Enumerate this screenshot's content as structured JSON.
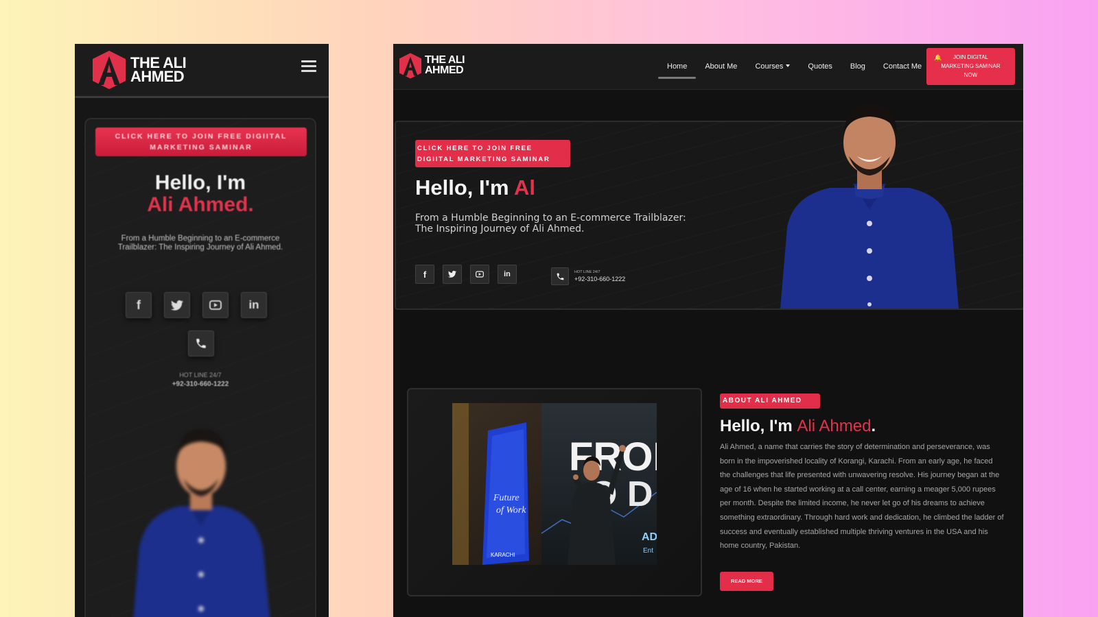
{
  "brand": {
    "logo_line1": "THE ALI",
    "logo_line2": "AHMED",
    "accent": "#e5324c"
  },
  "mobile": {
    "cta": "CLICK HERE TO JOIN FREE DIGIITAL MARKETING SAMINAR",
    "hello": "Hello, I'm",
    "name": "Ali Ahmed.",
    "subtitle": "From a Humble Beginning to an E-commerce Trailblazer: The Inspiring Journey of Ali Ahmed.",
    "hotline_label": "HOT LINE 24/7",
    "hotline_number": "+92-310-660-1222",
    "social_icons": [
      "facebook-icon",
      "twitter-icon",
      "youtube-icon",
      "linkedin-icon"
    ]
  },
  "desktop": {
    "nav": {
      "items": [
        {
          "label": "Home",
          "active": true
        },
        {
          "label": "About Me"
        },
        {
          "label": "Courses",
          "dropdown": true
        },
        {
          "label": "Quotes"
        },
        {
          "label": "Blog"
        },
        {
          "label": "Contact Me"
        }
      ],
      "join_button": "JOIN DIGITAL MARKETING SAMINAR NOW"
    },
    "hero": {
      "cta": "CLICK HERE TO JOIN FREE DIGIITAL MARKETING SAMINAR",
      "hello": "Hello, I'm ",
      "name_partial": "Al",
      "subtitle": "From a Humble Beginning to an E-commerce Trailblazer: The Inspiring Journey of Ali Ahmed.",
      "hotline_label": "HOT LINE 24/7",
      "hotline_number": "+92-310-660-1222"
    },
    "about": {
      "badge": "ABOUT ALI AHMED",
      "title_prefix": "Hello, I'm ",
      "title_name": "Ali Ahmed",
      "title_suffix": ".",
      "body": "Ali Ahmed, a name that carries the story of determination and perseverance, was born in the impoverished locality of Korangi, Karachi. From an early age, he faced the challenges that life presented with unwavering resolve. His journey began at the age of 16 when he started working at a call center, earning a meager 5,000 rupees per month. Despite the limited income, he never let go of his dreams to achieve something extraordinary. Through hard work and dedication, he climbed the ladder of success and eventually established multiple thriving ventures in the USA and his home country, Pakistan.",
      "read_more": "READ MORE",
      "photo_text": {
        "banner_line1": "Future",
        "banner_line2": "of Work",
        "banner_city": "KARACHI",
        "screen_big": "FROI",
        "screen_big2": "O D",
        "screen_small": "AD",
        "screen_small2": "Ent"
      }
    }
  }
}
